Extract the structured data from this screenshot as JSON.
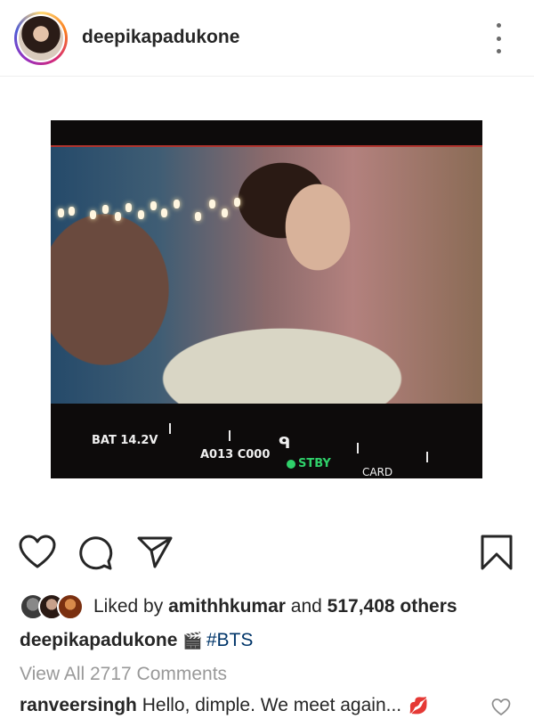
{
  "header": {
    "username": "deepikapadukone"
  },
  "photo_hud": {
    "battery": "BAT 14.2V",
    "clip": "A013 C000",
    "status": "STBY",
    "card": "CARD"
  },
  "likes": {
    "prefix": "Liked by ",
    "first_user": "amithhkumar",
    "middle": " and ",
    "others": "517,408 others"
  },
  "caption": {
    "username": "deepikapadukone",
    "emoji": "🎬",
    "hashtag": "#BTS"
  },
  "view_all_comments": "View All 2717 Comments",
  "comment": {
    "username": "ranveersingh",
    "text": " Hello, dimple. We meet again...",
    "emoji": "💋"
  },
  "icons": [
    "more-icon",
    "heart-icon",
    "comment-icon",
    "share-icon",
    "bookmark-icon"
  ],
  "colors": {
    "link": "#003569",
    "muted": "#999999",
    "text": "#262626",
    "stby": "#2fd06a"
  }
}
